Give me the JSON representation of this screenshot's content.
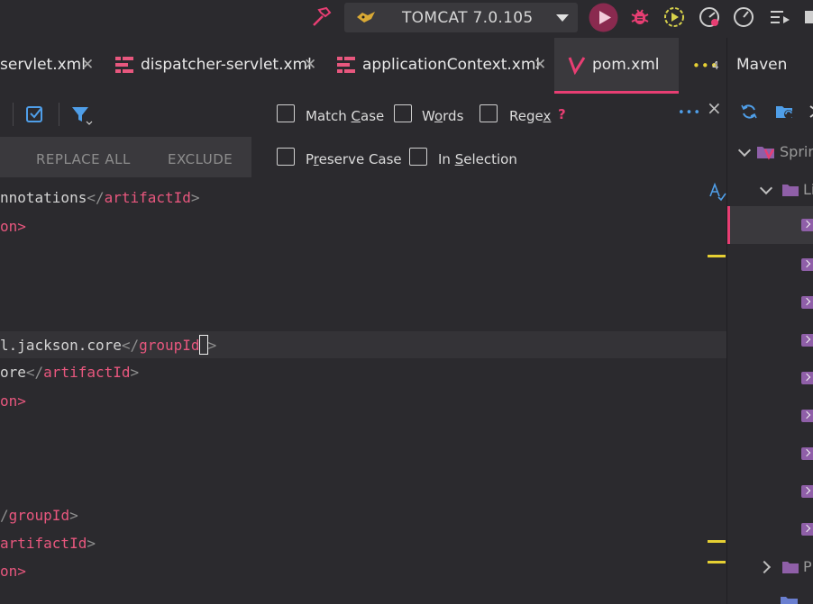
{
  "toolbar": {
    "run_config_label": "TOMCAT 7.0.105",
    "icons": [
      "hammer-icon",
      "tomcat-icon",
      "run-icon",
      "debug-icon",
      "coverage-icon",
      "profile-icon",
      "performance-icon",
      "run-list-icon",
      "stop-icon"
    ]
  },
  "tabs": [
    {
      "label": "servlet.xml",
      "active": false
    },
    {
      "label": "dispatcher-servlet.xml",
      "active": false
    },
    {
      "label": "applicationContext.xml",
      "active": false
    },
    {
      "label": "pom.xml",
      "active": true
    }
  ],
  "tabs_overflow": {
    "dots": "•••",
    "count": "4"
  },
  "find": {
    "options": [
      {
        "label": "Match Case",
        "underline": "C",
        "checked": false
      },
      {
        "label": "Words",
        "underline": "o",
        "checked": false
      },
      {
        "label": "Regex",
        "underline": "x",
        "checked": false
      },
      {
        "label": "Preserve Case",
        "underline": "r",
        "checked": false
      },
      {
        "label": "In Selection",
        "underline": "S",
        "checked": false
      }
    ],
    "help": "?",
    "more": "•••",
    "close": "×",
    "buttons": {
      "replace_all": "REPLACE ALL",
      "exclude": "EXCLUDE"
    }
  },
  "editor": {
    "lines": [
      {
        "text": "nnotations",
        "close_tag": "artifactId"
      },
      {
        "text": "",
        "close_tag": "",
        "tail": "on>"
      },
      {
        "text": "l.jackson.core",
        "close_tag": "groupId",
        "current": true
      },
      {
        "text": "ore",
        "close_tag": "artifactId"
      },
      {
        "text": "",
        "close_tag": "",
        "tail": "on>"
      },
      {
        "text": "",
        "close_tag": "groupId",
        "prefix": "/"
      },
      {
        "text": "",
        "close_tag": "artifactId",
        "prefix": ""
      },
      {
        "text": "",
        "close_tag": "",
        "tail": "on>"
      }
    ]
  },
  "maven": {
    "title": "Maven",
    "tree": [
      {
        "label": "Sprin",
        "expanded": true
      },
      {
        "label": "Li",
        "expanded": true
      },
      {
        "label": "Pl",
        "expanded": false
      }
    ]
  },
  "colors": {
    "accent": "#e83e73",
    "tag": "#e8577e",
    "marker": "#e6d033",
    "background": "#2b2a2e"
  }
}
